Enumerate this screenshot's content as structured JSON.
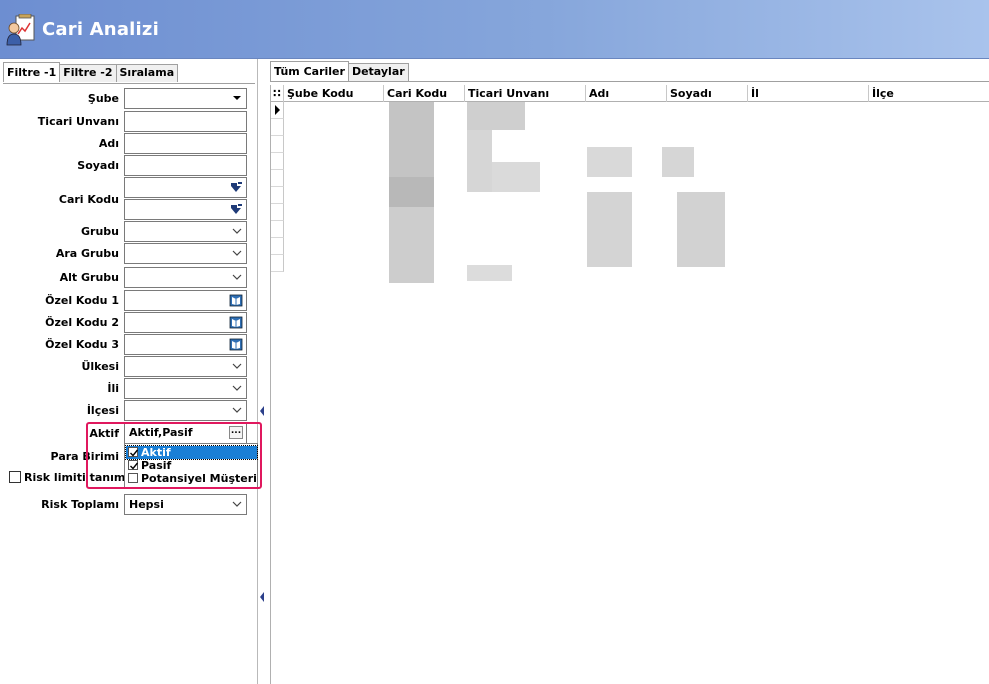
{
  "window": {
    "title": "Cari Analizi",
    "icon": "report-chart-icon"
  },
  "left_panel": {
    "tabs": [
      {
        "label": "Filtre -1",
        "active": true
      },
      {
        "label": "Filtre -2",
        "active": false
      },
      {
        "label": "Sıralama",
        "active": false
      }
    ],
    "fields": {
      "sube": {
        "label": "Şube",
        "value": ""
      },
      "ticari_unvani": {
        "label": "Ticari Unvanı",
        "value": ""
      },
      "adi": {
        "label": "Adı",
        "value": ""
      },
      "soyadi": {
        "label": "Soyadı",
        "value": ""
      },
      "cari_kodu": {
        "label": "Cari Kodu",
        "value_from": "",
        "value_to": ""
      },
      "grubu": {
        "label": "Grubu",
        "value": ""
      },
      "ara_grubu": {
        "label": "Ara Grubu",
        "value": ""
      },
      "alt_grubu": {
        "label": "Alt Grubu",
        "value": ""
      },
      "ozel_kodu_1": {
        "label": "Özel Kodu 1",
        "value": ""
      },
      "ozel_kodu_2": {
        "label": "Özel Kodu 2",
        "value": ""
      },
      "ozel_kodu_3": {
        "label": "Özel Kodu 3",
        "value": ""
      },
      "ulkesi": {
        "label": "Ülkesi",
        "value": ""
      },
      "ili": {
        "label": "İli",
        "value": ""
      },
      "ilcesi": {
        "label": "İlçesi",
        "value": ""
      },
      "aktif": {
        "label": "Aktif",
        "value": "Aktif,Pasif",
        "button": "..."
      },
      "para_birimi": {
        "label": "Para Birimi"
      },
      "risk_limiti": {
        "label": "Risk limiti tanımla",
        "checked": false
      },
      "risk_toplami": {
        "label": "Risk Toplamı",
        "value": "Hepsi"
      }
    },
    "aktif_dropdown": {
      "items": [
        {
          "label": "Aktif",
          "checked": true,
          "selected": true
        },
        {
          "label": "Pasif",
          "checked": true,
          "selected": false
        },
        {
          "label": "Potansiyel Müşteri",
          "checked": false,
          "selected": false
        }
      ]
    }
  },
  "right_panel": {
    "tabs": [
      {
        "label": "Tüm Cariler",
        "active": true
      },
      {
        "label": "Detaylar",
        "active": false
      }
    ],
    "grid": {
      "columns": [
        "Şube Kodu",
        "Cari Kodu",
        "Ticari Unvanı",
        "Adı",
        "Soyadı",
        "İl",
        "İlçe"
      ],
      "row_count": 10
    }
  },
  "colors": {
    "title_bar": "#7a9ad6",
    "highlight": "#e0185e",
    "selection": "#1a7fd6"
  }
}
